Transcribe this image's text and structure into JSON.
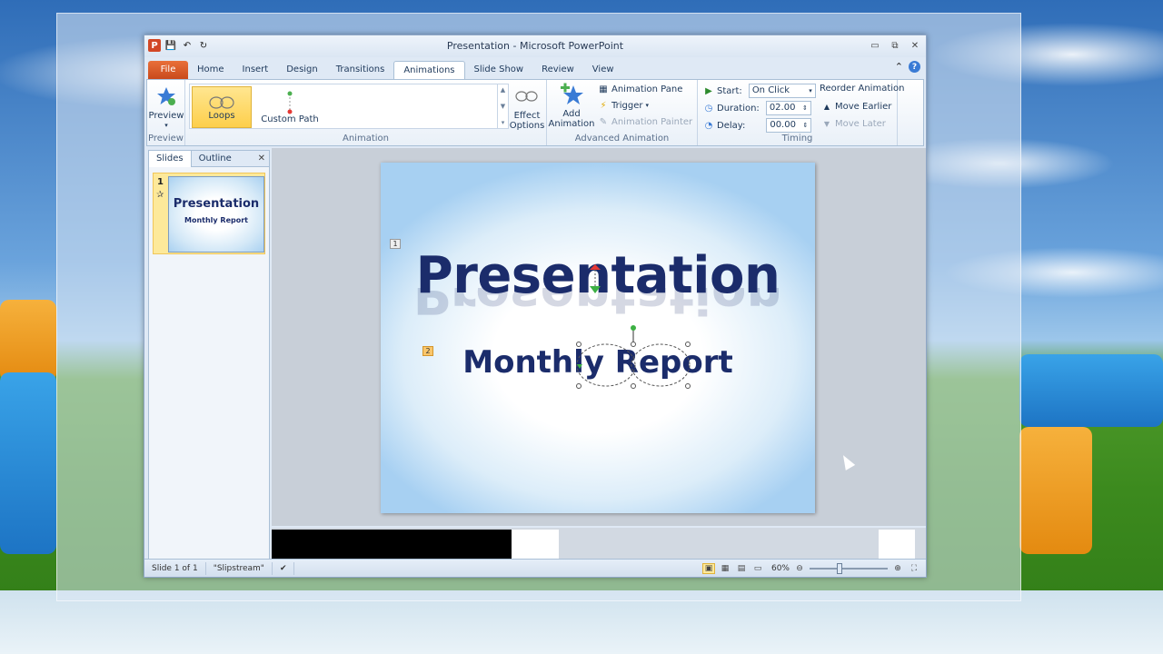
{
  "window": {
    "title": "Presentation  -  Microsoft PowerPoint",
    "qat": {
      "app_icon": "P",
      "save_icon": "💾",
      "undo_icon": "↶",
      "redo_icon": "↻"
    },
    "controls": {
      "minimize": "▭",
      "restore": "⧉",
      "close": "✕"
    }
  },
  "tabs": [
    "File",
    "Home",
    "Insert",
    "Design",
    "Transitions",
    "Animations",
    "Slide Show",
    "Review",
    "View"
  ],
  "tabs_right": {
    "collapse": "⌃",
    "help": "?"
  },
  "ribbon": {
    "preview": {
      "label": "Preview",
      "group_label": "Preview"
    },
    "animation": {
      "group_label": "Animation",
      "items": [
        {
          "label": "Loops",
          "selected": true
        },
        {
          "label": "Custom Path",
          "selected": false
        }
      ],
      "effect_options": {
        "line1": "Effect",
        "line2": "Options"
      }
    },
    "advanced": {
      "group_label": "Advanced Animation",
      "add_animation": {
        "line1": "Add",
        "line2": "Animation"
      },
      "animation_pane": "Animation Pane",
      "trigger": "Trigger",
      "animation_painter": "Animation Painter"
    },
    "timing": {
      "group_label": "Timing",
      "start_label": "Start:",
      "start_value": "On Click",
      "duration_label": "Duration:",
      "duration_value": "02.00",
      "delay_label": "Delay:",
      "delay_value": "00.00",
      "reorder_label": "Reorder Animation",
      "move_earlier": "Move Earlier",
      "move_later": "Move Later"
    }
  },
  "left_pane": {
    "tabs": [
      "Slides",
      "Outline"
    ],
    "close": "✕",
    "thumbnail": {
      "number": "1",
      "star": "✰",
      "title": "Presentation",
      "subtitle": "Monthly Report"
    }
  },
  "slide": {
    "title": "Presentation",
    "subtitle": "Monthly Report",
    "anim_tag_1": "1",
    "anim_tag_2": "2"
  },
  "status_bar": {
    "slide_info": "Slide 1 of 1",
    "theme": "\"Slipstream\"",
    "zoom": "60%"
  }
}
